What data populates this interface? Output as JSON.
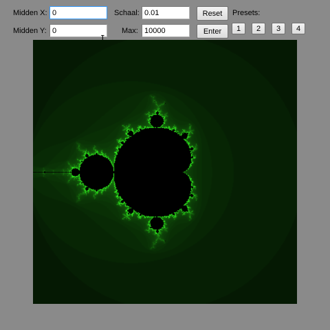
{
  "controls": {
    "midden_x_label": "Midden X:",
    "midden_x_value": "0",
    "midden_y_label": "Midden Y:",
    "midden_y_value": "0",
    "schaal_label": "Schaal:",
    "schaal_value": "0.01",
    "max_label": "Max:",
    "max_value": "10000",
    "reset_label": "Reset",
    "enter_label": "Enter",
    "presets_label": "Presets:",
    "presets": [
      "1",
      "2",
      "3",
      "4"
    ]
  },
  "fractal": {
    "type": "mandelbrot",
    "center_x": 0,
    "center_y": 0,
    "scale": 0.01,
    "max_iterations": 10000,
    "colors": {
      "set": "#000000",
      "glow": "#33ff33",
      "halo": "#0d260d"
    }
  }
}
